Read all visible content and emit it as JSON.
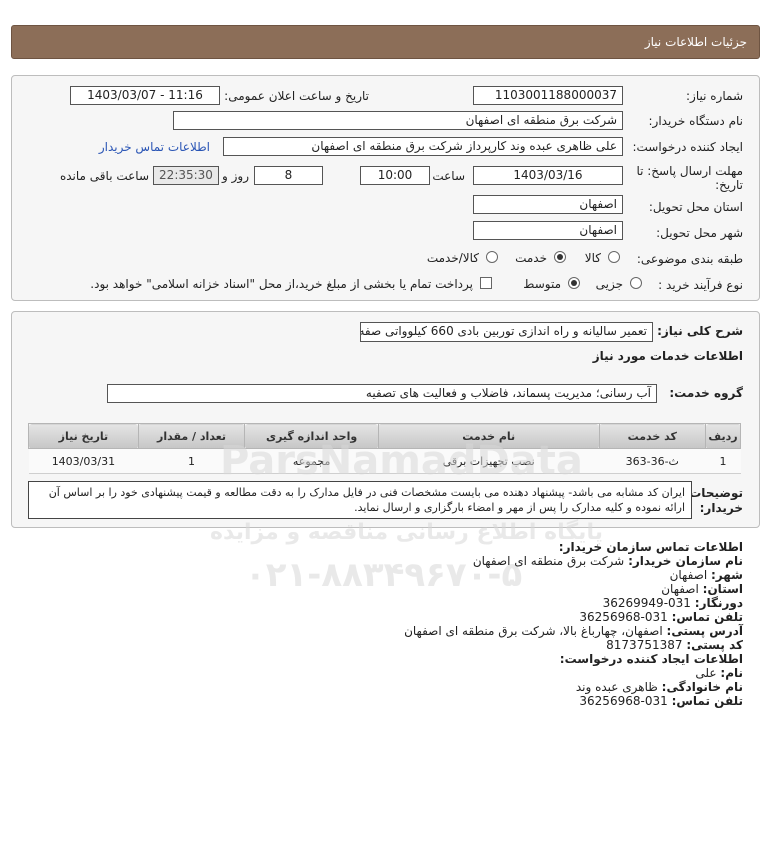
{
  "page_title": "جزئیات اطلاعات نیاز",
  "need_number": {
    "label": "شماره نیاز:",
    "value": "1103001188000037"
  },
  "announce": {
    "label": "تاریخ و ساعت اعلان عمومی:",
    "value": "1403/03/07 - 11:16"
  },
  "buyer_org": {
    "label": "نام دستگاه خریدار:",
    "value": "شرکت برق منطقه ای اصفهان"
  },
  "creator": {
    "label": "ایجاد کننده درخواست:",
    "value": "علی ظاهری عبده وند کارپرداز شرکت برق منطقه ای اصفهان",
    "contact_link": "اطلاعات تماس خریدار"
  },
  "deadline": {
    "label": "مهلت ارسال پاسخ: تا تاریخ:",
    "date": "1403/03/16",
    "time_label": "ساعت",
    "time": "10:00",
    "days": "8",
    "days_label": "روز و",
    "remaining": "22:35:30",
    "remaining_label": "ساعت باقی مانده"
  },
  "province": {
    "label": "استان محل تحویل:",
    "value": "اصفهان"
  },
  "city": {
    "label": "شهر محل تحویل:",
    "value": "اصفهان"
  },
  "category": {
    "label": "طبقه بندی موضوعی:",
    "options": [
      "کالا",
      "خدمت",
      "کالا/خدمت"
    ],
    "selected": "خدمت"
  },
  "purchase_process": {
    "label": "نوع فرآیند خرید :",
    "options": [
      "جزیی",
      "متوسط"
    ],
    "selected": "متوسط",
    "payment_text": "پرداخت تمام یا بخشی از مبلغ خرید،از محل \"اسناد خزانه اسلامی\" خواهد بود."
  },
  "summary": {
    "label": "شرح کلی نیاز:",
    "value": "تعمیر سالیانه و راه اندازی توربین بادی 660 کیلوواتی صفه"
  },
  "services_title": "اطلاعات خدمات مورد نیاز",
  "service_group": {
    "label": "گروه خدمت:",
    "value": "آب رسانی؛ مدیریت پسماند، فاضلاب و فعالیت های تصفیه"
  },
  "table": {
    "headers": [
      "ردیف",
      "کد خدمت",
      "نام خدمت",
      "واحد اندازه گیری",
      "تعداد / مقدار",
      "تاریخ نیاز"
    ],
    "rows": [
      [
        "1",
        "ث-36-363",
        "نصب تجهیزات برقی",
        "مجموعه",
        "1",
        "1403/03/31"
      ]
    ]
  },
  "buyer_notes": {
    "label": "توضیحات خریدار:",
    "text": "ایران کد مشابه می باشد- پیشنهاد دهنده می بایست مشخصات فنی در فایل مدارک را به دقت مطالعه و قیمت پیشنهادی خود را بر اساس آن ارائه نموده و کلیه مدارک را پس از مهر و امضاء بارگزاری و ارسال نماید."
  },
  "contact": {
    "title": "اطلاعات تماس سازمان خریدار:",
    "org_label": "نام سازمان خریدار:",
    "org": "شرکت برق منطقه ای اصفهان",
    "city_label": "شهر:",
    "city": "اصفهان",
    "province_label": "استان:",
    "province": "اصفهان",
    "fax_label": "دورنگار:",
    "fax": "031-36269949",
    "phone_label": "تلفن تماس:",
    "phone": "031-36256968",
    "address_label": "آدرس پستی:",
    "address": "اصفهان، چهارباغ بالا، شرکت برق منطقه ای اصفهان",
    "postal_label": "کد پستی:",
    "postal": "8173751387",
    "creator_title": "اطلاعات ایجاد کننده درخواست:",
    "name_label": "نام:",
    "name": "علی",
    "family_label": "نام خانوادگی:",
    "family": "ظاهری عبده وند",
    "creator_phone_label": "تلفن تماس:",
    "creator_phone": "031-36256968"
  },
  "watermark": {
    "brand": "ParsNamadData",
    "tagline": "پایگاه اطلاع رسانی مناقصه و مزایده",
    "phone": "۰۲۱-۸۸۳۴۹۶۷۰-۵"
  }
}
